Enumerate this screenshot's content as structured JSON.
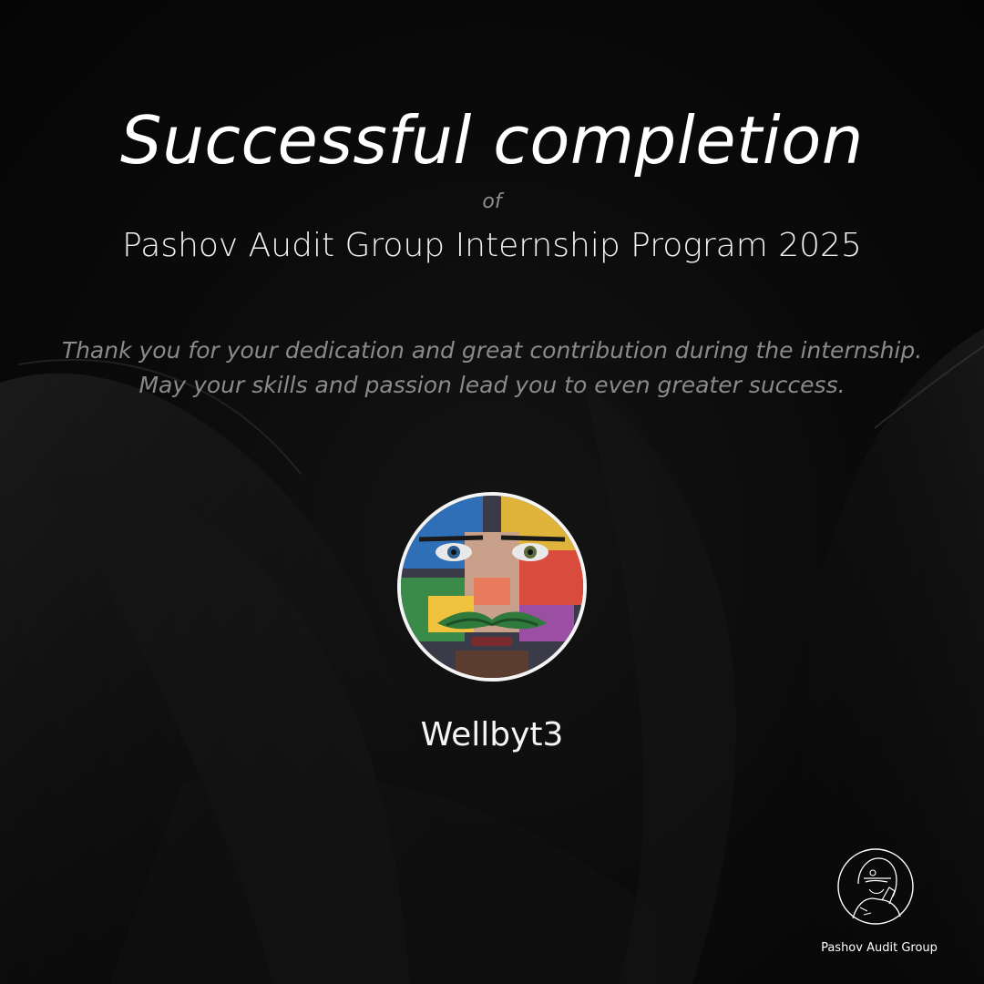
{
  "certificate": {
    "title": "Successful completion",
    "of": "of",
    "program": "Pashov Audit Group Internship Program 2025",
    "thanks_line1": "Thank you for your dedication and great contribution during the internship.",
    "thanks_line2": "May your skills and passion lead you to even greater success.",
    "recipient_name": "Wellbyt3"
  },
  "branding": {
    "org_name": "Pashov Audit Group",
    "logo_icon": "hooded-figure-logo-icon",
    "avatar_icon": "painted-face-avatar"
  },
  "colors": {
    "background": "#070707",
    "text_primary": "#ffffff",
    "text_muted": "#8a8a8a",
    "avatar_border": "#f4f4f4"
  }
}
